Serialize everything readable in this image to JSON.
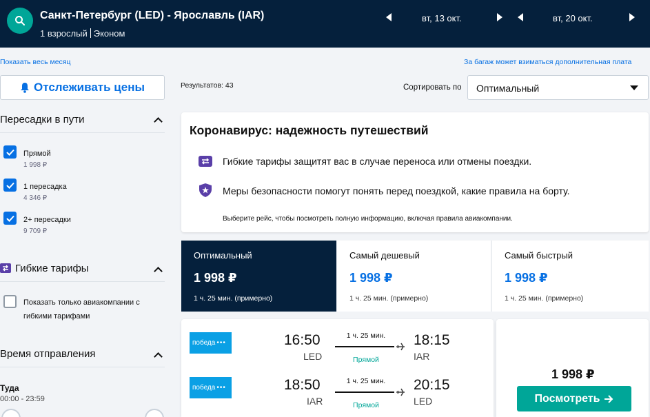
{
  "header": {
    "route": "Санкт-Петербург (LED) - Ярославль (IAR)",
    "passengers": "1 взрослый",
    "cabin": "Эконом",
    "depart_date": "вт, 13 окт.",
    "return_date": "вт, 20 окт."
  },
  "links": {
    "show_month": "Показать весь месяц",
    "baggage_note": "За багаж может взиматься дополнительная плата"
  },
  "track_prices": {
    "label": "Отслеживать цены"
  },
  "results": {
    "label": "Результатов: 43"
  },
  "sort": {
    "label": "Сортировать по",
    "selected": "Оптимальный"
  },
  "filters": {
    "stops": {
      "title": "Пересадки в пути",
      "options": [
        {
          "label": "Прямой",
          "price": "1 998 ₽",
          "checked": true
        },
        {
          "label": "1 пересадка",
          "price": "4 346 ₽",
          "checked": true
        },
        {
          "label": "2+ пересадки",
          "price": "9 709 ₽",
          "checked": true
        }
      ]
    },
    "flexible": {
      "title": "Гибкие тарифы",
      "option_line1": "Показать только авиакомпании с",
      "option_line2": "гибкими тарифами"
    },
    "departure": {
      "title": "Время отправления",
      "outbound_label": "Туда",
      "outbound_range": "00:00 - 23:59"
    }
  },
  "covid": {
    "title": "Коронавирус: надежность путешествий",
    "line1": "Гибкие тарифы защитят вас в случае переноса или отмены поездки.",
    "line2": "Меры безопасности помогут понять перед поездкой, какие правила на борту.",
    "note": "Выберите рейс, чтобы посмотреть полную информацию, включая правила авиакомпании."
  },
  "tabs": [
    {
      "title": "Оптимальный",
      "price": "1 998 ₽",
      "duration": "1 ч. 25 мин. (примерно)",
      "active": true
    },
    {
      "title": "Самый дешевый",
      "price": "1 998 ₽",
      "duration": "1 ч. 25 мин. (примерно)",
      "active": false
    },
    {
      "title": "Самый быстрый",
      "price": "1 998 ₽",
      "duration": "1 ч. 25 мин. (примерно)",
      "active": false
    }
  ],
  "itinerary": {
    "airline": "победа",
    "legs": [
      {
        "dep_time": "16:50",
        "dep_code": "LED",
        "duration": "1 ч. 25 мин.",
        "stops": "Прямой",
        "arr_time": "18:15",
        "arr_code": "IAR"
      },
      {
        "dep_time": "18:50",
        "dep_code": "IAR",
        "duration": "1 ч. 25 мин.",
        "stops": "Прямой",
        "arr_time": "20:15",
        "arr_code": "LED"
      }
    ],
    "price": "1 998 ₽",
    "view_label": "Посмотреть"
  },
  "colors": {
    "header_bg": "#05203c",
    "accent_blue": "#0770e3",
    "accent_green": "#00a698"
  }
}
